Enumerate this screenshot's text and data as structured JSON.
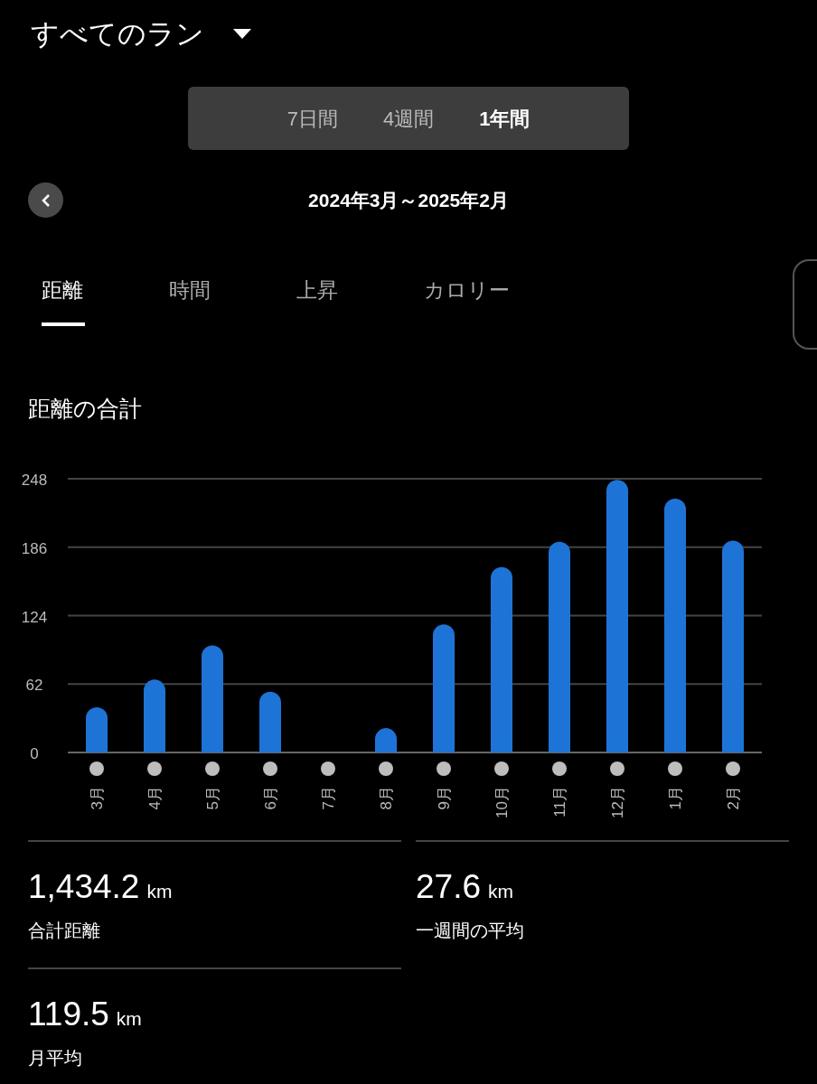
{
  "header": {
    "title": "すべてのラン"
  },
  "period_tabs": [
    {
      "label": "7日間",
      "selected": false
    },
    {
      "label": "4週間",
      "selected": false
    },
    {
      "label": "1年間",
      "selected": true
    }
  ],
  "date_range": "2024年3月～2025年2月",
  "metric_tabs": [
    {
      "label": "距離",
      "selected": true
    },
    {
      "label": "時間",
      "selected": false
    },
    {
      "label": "上昇",
      "selected": false
    },
    {
      "label": "カロリー",
      "selected": false
    }
  ],
  "chart_title": "距離の合計",
  "chart_data": {
    "type": "bar",
    "categories": [
      "3月",
      "4月",
      "5月",
      "6月",
      "7月",
      "8月",
      "9月",
      "10月",
      "11月",
      "12月",
      "1月",
      "2月"
    ],
    "grid": true,
    "series": [
      {
        "color": "#1e74d6",
        "values": [
          41,
          66,
          97,
          55,
          0,
          22,
          116,
          168,
          191,
          247,
          230,
          192
        ]
      }
    ],
    "ylim": [
      0,
      248
    ],
    "yticks": [
      0,
      62,
      124,
      186,
      248
    ]
  },
  "stats": [
    {
      "value": "1,434.2",
      "unit": "km",
      "label": "合計距離"
    },
    {
      "value": "27.6",
      "unit": "km",
      "label": "一週間の平均"
    },
    {
      "value": "119.5",
      "unit": "km",
      "label": "月平均"
    }
  ]
}
